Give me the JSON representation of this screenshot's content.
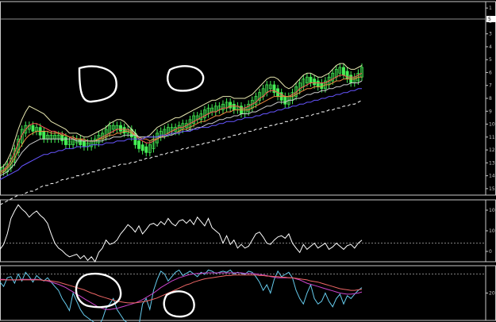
{
  "chart_data": [
    {
      "type": "line",
      "panel": "price",
      "title": "",
      "axis_side": "right",
      "ylim": [
        0,
        100
      ],
      "y_ticks": [
        "1",
        "2",
        "3",
        "4",
        "5",
        "6",
        "7",
        "8",
        "9",
        "10",
        "11",
        "12",
        "13",
        "14",
        "15"
      ],
      "current_value": "5",
      "series": [
        {
          "key": "candles",
          "color": "#44ee55",
          "values": [
            13,
            13,
            15,
            18,
            23,
            28,
            33,
            35,
            35,
            34,
            34,
            32,
            30,
            30,
            30,
            30,
            30,
            29,
            27,
            27,
            28,
            28,
            27,
            26,
            26,
            27,
            28,
            30,
            31,
            33,
            35,
            35,
            35,
            34,
            33,
            33,
            31,
            27,
            25,
            24,
            23,
            25,
            28,
            31,
            32,
            33,
            34,
            34,
            34,
            35,
            36,
            36,
            38,
            40,
            40,
            41,
            43,
            44,
            44,
            45,
            45,
            46,
            47,
            46,
            45,
            45,
            43,
            44,
            46,
            48,
            50,
            52,
            54,
            56,
            56,
            54,
            52,
            50,
            48,
            50,
            52,
            55,
            57,
            59,
            60,
            59,
            58,
            57,
            56,
            58,
            60,
            62,
            64,
            65,
            63,
            61,
            59,
            60,
            62,
            65
          ]
        },
        {
          "key": "envelope_upper",
          "color": "#e8e8b0",
          "values": [
            14,
            15,
            18,
            22,
            28,
            34,
            39,
            43,
            46,
            45,
            44,
            43,
            42,
            40,
            38,
            37,
            36,
            35,
            34,
            32,
            32,
            32,
            31,
            30,
            30,
            31,
            32,
            33,
            34,
            35,
            37,
            38,
            39,
            39,
            38,
            36,
            34,
            32,
            30,
            30,
            30,
            31,
            33,
            35,
            36,
            37,
            38,
            39,
            40,
            40,
            41,
            42,
            43,
            44,
            45,
            46,
            47,
            48,
            49,
            49,
            50,
            51,
            51,
            51,
            50,
            50,
            50,
            50,
            51,
            52,
            54,
            56,
            58,
            60,
            61,
            61,
            60,
            58,
            56,
            55,
            56,
            58,
            60,
            62,
            63,
            63,
            62,
            61,
            61,
            62,
            63,
            65,
            67,
            68,
            68,
            66,
            65,
            65,
            66,
            67
          ]
        },
        {
          "key": "ma_fast",
          "color": "#ff5555",
          "values": [
            12,
            13,
            15,
            18,
            22,
            27,
            31,
            34,
            36,
            37,
            37,
            36,
            35,
            34,
            33,
            33,
            32,
            32,
            31,
            30,
            29,
            29,
            29,
            28,
            28,
            28,
            28,
            29,
            30,
            31,
            32,
            33,
            34,
            34,
            34,
            34,
            33,
            31,
            29,
            28,
            27,
            27,
            28,
            29,
            30,
            31,
            32,
            33,
            34,
            35,
            35,
            36,
            37,
            38,
            39,
            40,
            41,
            42,
            43,
            43,
            44,
            45,
            45,
            46,
            46,
            46,
            45,
            45,
            46,
            47,
            48,
            50,
            51,
            53,
            54,
            54,
            53,
            52,
            51,
            51,
            52,
            53,
            55,
            56,
            57,
            58,
            58,
            58,
            58,
            58,
            59,
            60,
            61,
            62,
            62,
            61,
            61,
            61,
            62,
            63
          ]
        },
        {
          "key": "ma_mid",
          "color": "#ee8844",
          "values": [
            11,
            12,
            14,
            16,
            19,
            23,
            26,
            29,
            31,
            32,
            33,
            33,
            33,
            33,
            32,
            32,
            32,
            31,
            31,
            30,
            30,
            29,
            29,
            29,
            28,
            28,
            28,
            29,
            29,
            30,
            31,
            31,
            32,
            32,
            33,
            33,
            32,
            31,
            30,
            29,
            29,
            28,
            29,
            29,
            30,
            30,
            31,
            32,
            32,
            33,
            34,
            34,
            35,
            36,
            37,
            38,
            38,
            39,
            40,
            41,
            41,
            42,
            43,
            43,
            44,
            44,
            44,
            44,
            44,
            45,
            46,
            47,
            48,
            49,
            50,
            51,
            51,
            51,
            51,
            51,
            51,
            52,
            53,
            54,
            55,
            55,
            56,
            56,
            56,
            57,
            57,
            58,
            59,
            59,
            60,
            60,
            60,
            60,
            61,
            61
          ]
        },
        {
          "key": "ma_slow",
          "color": "#cccccc",
          "values": [
            10,
            11,
            12,
            14,
            16,
            19,
            22,
            24,
            26,
            27,
            28,
            29,
            29,
            29,
            29,
            29,
            29,
            29,
            29,
            29,
            29,
            28,
            28,
            28,
            28,
            28,
            28,
            28,
            28,
            29,
            29,
            30,
            30,
            30,
            31,
            31,
            31,
            31,
            30,
            30,
            30,
            30,
            30,
            30,
            30,
            30,
            31,
            31,
            32,
            32,
            33,
            33,
            34,
            34,
            35,
            35,
            36,
            37,
            37,
            38,
            39,
            39,
            40,
            40,
            41,
            41,
            42,
            42,
            42,
            43,
            43,
            44,
            45,
            46,
            46,
            47,
            48,
            48,
            48,
            49,
            49,
            50,
            50,
            51,
            52,
            52,
            53,
            53,
            54,
            54,
            55,
            55,
            56,
            56,
            57,
            57,
            58,
            58,
            58,
            59
          ]
        },
        {
          "key": "ma_long",
          "color": "#6655ff",
          "values": [
            8,
            9,
            10,
            11,
            12,
            13,
            15,
            16,
            17,
            18,
            19,
            20,
            21,
            21,
            22,
            22,
            23,
            23,
            24,
            24,
            24,
            25,
            25,
            25,
            25,
            26,
            26,
            26,
            26,
            27,
            27,
            27,
            28,
            28,
            28,
            29,
            29,
            29,
            29,
            29,
            30,
            30,
            30,
            30,
            31,
            31,
            31,
            32,
            32,
            32,
            33,
            33,
            33,
            34,
            34,
            35,
            35,
            35,
            36,
            36,
            37,
            37,
            38,
            38,
            38,
            39,
            39,
            40,
            40,
            40,
            41,
            41,
            42,
            42,
            43,
            43,
            44,
            44,
            45,
            45,
            46,
            46,
            47,
            47,
            48,
            48,
            49,
            49,
            50,
            50,
            51,
            51,
            52,
            52,
            53,
            53,
            54,
            54,
            55,
            55
          ]
        },
        {
          "key": "ma_dashed",
          "color": "#e8e8e8",
          "dashed": true,
          "values": [
            -5,
            -4,
            -3,
            -2,
            -1,
            0,
            0,
            1,
            2,
            2,
            3,
            4,
            5,
            5,
            6,
            6,
            7,
            8,
            8,
            9,
            9,
            10,
            10,
            11,
            11,
            12,
            12,
            13,
            13,
            14,
            14,
            15,
            15,
            16,
            16,
            16,
            17,
            17,
            18,
            18,
            19,
            19,
            20,
            20,
            21,
            21,
            22,
            22,
            23,
            23,
            24,
            24,
            25,
            25,
            26,
            26,
            27,
            27,
            28,
            28,
            29,
            29,
            30,
            30,
            31,
            31,
            32,
            32,
            33,
            33,
            34,
            34,
            35,
            35,
            36,
            36,
            37,
            37,
            38,
            38,
            39,
            39,
            40,
            40,
            41,
            41,
            42,
            42,
            43,
            43,
            44,
            44,
            45,
            45,
            46,
            46,
            47,
            47,
            48,
            49
          ]
        }
      ]
    },
    {
      "type": "line",
      "panel": "oscillator_1",
      "title": "",
      "axis_side": "right",
      "ylim": [
        0,
        100
      ],
      "y_ticks": [
        "10",
        "10",
        "0"
      ],
      "level_line": 30,
      "series": [
        {
          "key": "oscillator",
          "color": "#ffffff",
          "values": [
            20,
            28,
            45,
            70,
            82,
            92,
            85,
            80,
            72,
            78,
            82,
            75,
            70,
            62,
            45,
            30,
            22,
            18,
            12,
            8,
            10,
            12,
            5,
            10,
            2,
            8,
            0,
            15,
            22,
            35,
            28,
            30,
            35,
            45,
            52,
            60,
            55,
            48,
            58,
            45,
            52,
            60,
            62,
            58,
            65,
            60,
            70,
            62,
            58,
            66,
            68,
            62,
            68,
            60,
            72,
            65,
            58,
            70,
            55,
            50,
            45,
            30,
            42,
            28,
            35,
            22,
            28,
            22,
            25,
            35,
            45,
            48,
            40,
            30,
            28,
            35,
            40,
            42,
            38,
            45,
            30,
            22,
            15,
            28,
            20,
            25,
            30,
            22,
            26,
            30,
            20,
            24,
            30,
            25,
            20,
            26,
            28,
            22,
            30,
            35
          ]
        }
      ]
    },
    {
      "type": "line",
      "panel": "oscillator_2",
      "title": "",
      "axis_side": "right",
      "ylim": [
        0,
        100
      ],
      "y_ticks": [
        "20"
      ],
      "level_line": 85,
      "series": [
        {
          "key": "fast",
          "color": "#66ccee",
          "values": [
            70,
            62,
            78,
            80,
            68,
            85,
            72,
            88,
            80,
            70,
            82,
            76,
            72,
            78,
            70,
            62,
            55,
            40,
            30,
            18,
            50,
            35,
            20,
            10,
            5,
            0,
            -5,
            -10,
            2,
            22,
            30,
            40,
            20,
            10,
            0,
            -5,
            -15,
            -30,
            -10,
            30,
            40,
            20,
            55,
            75,
            90,
            85,
            72,
            80,
            88,
            92,
            82,
            86,
            90,
            85,
            80,
            88,
            84,
            92,
            90,
            86,
            88,
            90,
            88,
            92,
            85,
            88,
            86,
            84,
            90,
            88,
            80,
            70,
            55,
            65,
            50,
            75,
            90,
            80,
            84,
            88,
            78,
            55,
            40,
            30,
            50,
            65,
            40,
            30,
            35,
            50,
            35,
            25,
            40,
            48,
            30,
            45,
            40,
            48,
            55,
            60
          ]
        },
        {
          "key": "signal",
          "color": "#cc44cc",
          "values": [
            75,
            75,
            74,
            74,
            74,
            74,
            75,
            75,
            75,
            75,
            75,
            74,
            73,
            72,
            70,
            68,
            66,
            63,
            60,
            56,
            52,
            48,
            44,
            40,
            36,
            32,
            28,
            24,
            22,
            20,
            20,
            21,
            22,
            24,
            26,
            28,
            30,
            32,
            35,
            38,
            42,
            46,
            50,
            55,
            60,
            64,
            68,
            72,
            75,
            78,
            80,
            82,
            84,
            85,
            86,
            86,
            87,
            87,
            87,
            87,
            87,
            87,
            87,
            87,
            87,
            87,
            87,
            86,
            86,
            86,
            85,
            84,
            83,
            82,
            80,
            79,
            78,
            78,
            78,
            78,
            78,
            76,
            74,
            71,
            68,
            66,
            64,
            62,
            60,
            58,
            56,
            54,
            52,
            50,
            49,
            48,
            48,
            49,
            50,
            52
          ]
        },
        {
          "key": "slow",
          "color": "#ee6666",
          "values": [
            74,
            74,
            74,
            74,
            74,
            74,
            74,
            74,
            74,
            74,
            74,
            74,
            73,
            73,
            72,
            71,
            70,
            68,
            66,
            64,
            62,
            60,
            58,
            56,
            53,
            50,
            48,
            45,
            43,
            41,
            39,
            37,
            35,
            34,
            33,
            32,
            32,
            32,
            33,
            34,
            35,
            37,
            39,
            41,
            44,
            47,
            50,
            53,
            56,
            59,
            62,
            65,
            67,
            70,
            72,
            74,
            76,
            77,
            78,
            79,
            80,
            81,
            82,
            82,
            83,
            83,
            83,
            83,
            83,
            83,
            83,
            82,
            82,
            81,
            81,
            80,
            80,
            79,
            79,
            78,
            78,
            77,
            76,
            75,
            74,
            72,
            71,
            70,
            68,
            66,
            64,
            62,
            60,
            58,
            57,
            56,
            55,
            55,
            56,
            57
          ]
        }
      ]
    }
  ],
  "annotations": {
    "circle_color": "#ffffff"
  }
}
